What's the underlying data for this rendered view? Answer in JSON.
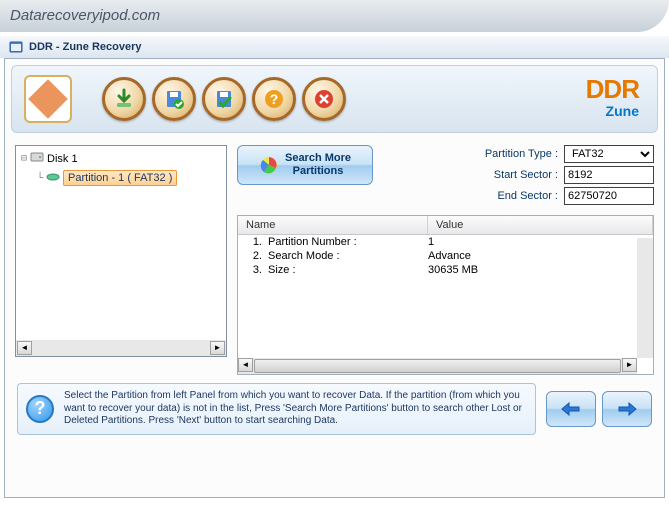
{
  "browser": {
    "url": "Datarecoveryipod.com"
  },
  "window": {
    "title": "DDR - Zune Recovery"
  },
  "brand": {
    "title": "DDR",
    "subtitle": "Zune"
  },
  "tree": {
    "root": "Disk 1",
    "child": "Partition - 1 ( FAT32 )"
  },
  "search_button": {
    "label": "Search More\nPartitions"
  },
  "fields": {
    "partition_type_label": "Partition Type :",
    "partition_type_value": "FAT32",
    "start_sector_label": "Start Sector :",
    "start_sector_value": "8192",
    "end_sector_label": "End Sector :",
    "end_sector_value": "62750720"
  },
  "table": {
    "headers": {
      "name": "Name",
      "value": "Value"
    },
    "rows": [
      {
        "num": "1.",
        "name": "Partition Number :",
        "value": "1"
      },
      {
        "num": "2.",
        "name": "Search Mode :",
        "value": "Advance"
      },
      {
        "num": "3.",
        "name": "Size :",
        "value": "30635 MB"
      }
    ]
  },
  "info": {
    "text": "Select the Partition from left Panel from which you want to recover Data. If the partition (from which you want to recover your data) is not in the list, Press 'Search More Partitions' button to search other Lost or Deleted Partitions. Press 'Next' button to start searching Data."
  }
}
